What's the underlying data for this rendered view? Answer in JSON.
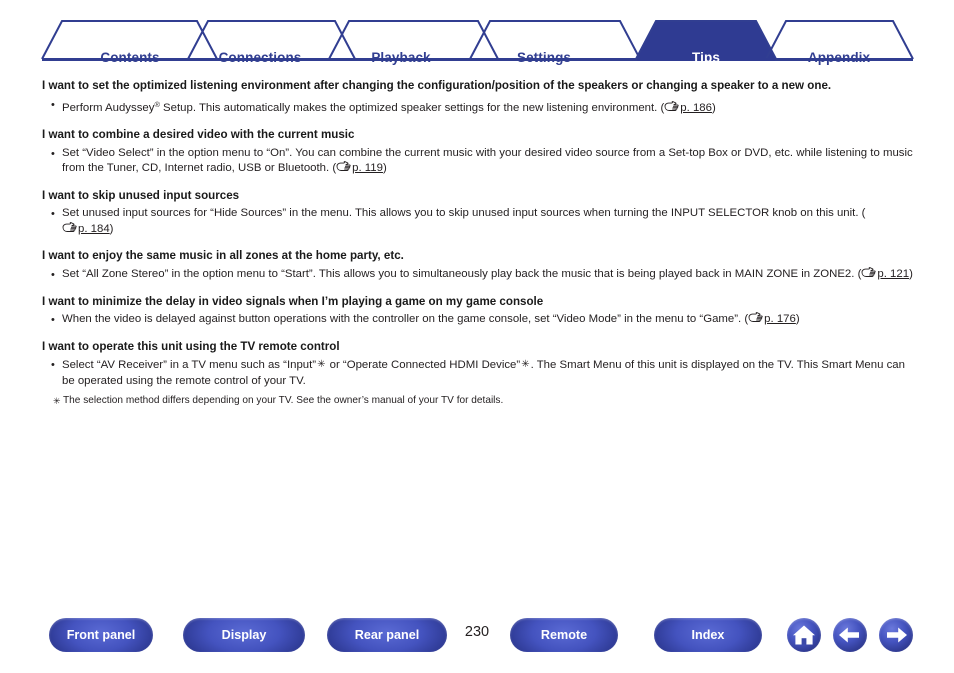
{
  "nav": {
    "tabs": [
      {
        "label": "Contents",
        "active": false
      },
      {
        "label": "Connections",
        "active": false
      },
      {
        "label": "Playback",
        "active": false
      },
      {
        "label": "Settings",
        "active": false
      },
      {
        "label": "Tips",
        "active": true
      },
      {
        "label": "Appendix",
        "active": false
      }
    ]
  },
  "colors": {
    "brand_navy": "#313e91",
    "active_tab_fill": "#2f3b92",
    "button_blue": "#4453bf",
    "text": "#231f20"
  },
  "sections": [
    {
      "heading": "I want to set the optimized listening environment after changing the configuration/position of the speakers or changing a speaker to a new one.",
      "bullet_pre": "Perform Audyssey",
      "bullet_sup": "®",
      "bullet_post": " Setup. This automatically makes the optimized speaker settings for the new listening environment.  (",
      "page_ref": "p. 186",
      "bullet_tail": ")"
    },
    {
      "heading": "I want to combine a desired video with the current music",
      "bullet_pre": "Set “Video Select” in the option menu to “On”. You can combine the current music with your desired video source from a Set-top Box or DVD, etc. while listening to music from the Tuner, CD, Internet radio, USB or Bluetooth.  (",
      "page_ref": "p. 119",
      "bullet_tail": ")"
    },
    {
      "heading": "I want to skip unused input sources",
      "bullet_pre": "Set unused input sources for “Hide Sources” in the menu. This allows you to skip unused input sources when turning the INPUT SELECTOR knob on this unit.  (",
      "page_ref": "p. 184",
      "bullet_tail": ")"
    },
    {
      "heading": "I want to enjoy the same music in all zones at the home party, etc.",
      "bullet_pre": "Set “All Zone Stereo” in the option menu to “Start”. This allows you to simultaneously play back the music that is being played back in MAIN ZONE in ZONE2.  (",
      "page_ref": "p. 121",
      "bullet_tail": ")"
    },
    {
      "heading": "I want to minimize the delay in video signals when I’m playing a game on my game console",
      "bullet_pre": "When the video is delayed against button operations with the controller on the game console, set “Video Mode” in the menu to “Game”.  (",
      "page_ref": "p. 176",
      "bullet_tail": ")"
    },
    {
      "heading": "I want to operate this unit using the TV remote control",
      "bullet_pre": "Select “AV Receiver” in a TV menu such as “Input”",
      "bullet_ast1": "✳",
      "bullet_mid": " or “Operate Connected HDMI Device”",
      "bullet_ast2": "✳",
      "bullet_post": ". The Smart Menu of this unit is displayed on the TV. This Smart Menu can be operated using the remote control of your TV.",
      "note_star": "✳",
      "note": "The selection method differs depending on your TV. See the owner’s manual of your TV for details."
    }
  ],
  "footer": {
    "buttons": [
      {
        "label": "Front panel"
      },
      {
        "label": "Display"
      },
      {
        "label": "Rear panel"
      },
      {
        "label": "Remote"
      },
      {
        "label": "Index"
      }
    ],
    "page_number": "230",
    "icons": [
      {
        "name": "home-icon"
      },
      {
        "name": "arrow-left-icon"
      },
      {
        "name": "arrow-right-icon"
      }
    ]
  }
}
